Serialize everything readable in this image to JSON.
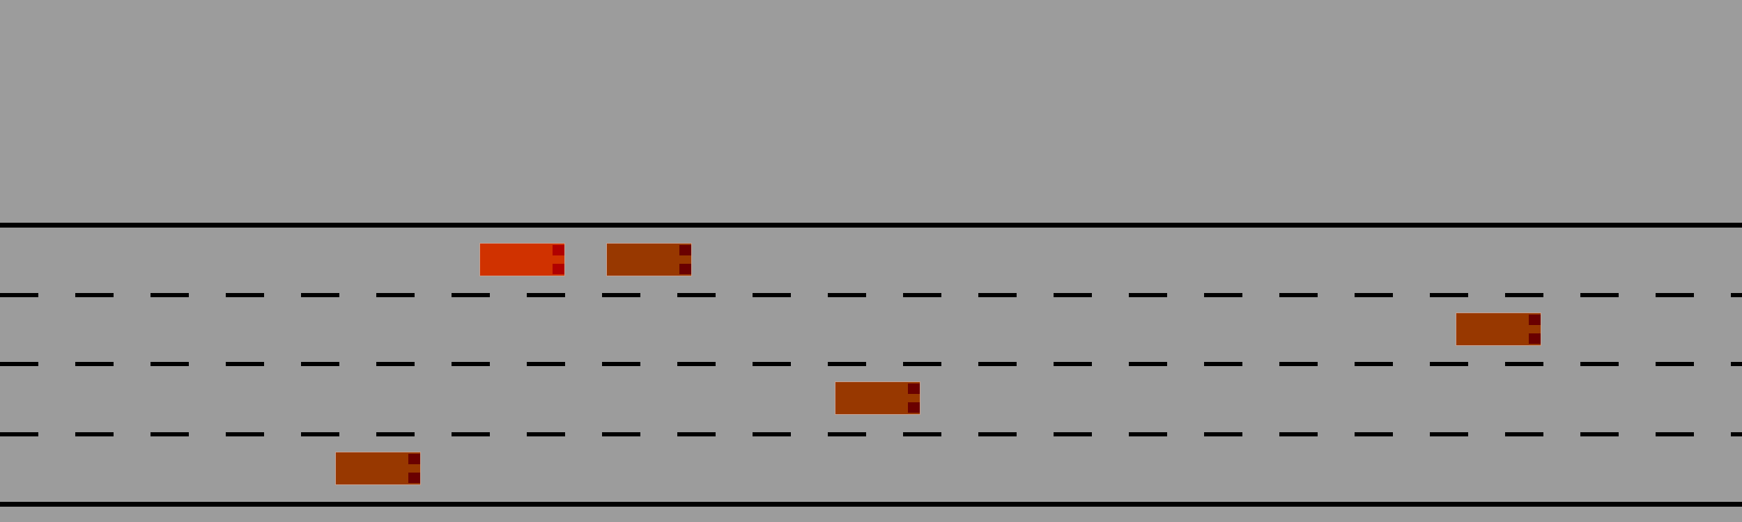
{
  "scene": {
    "background_color": "#9c9c9c",
    "road_line_color": "#000000",
    "lane_count": 4
  },
  "vehicles": [
    {
      "id": "ego",
      "role": "ego-vehicle",
      "lane": 1,
      "body_color": "#d03200",
      "light_color": "#b00000"
    },
    {
      "id": "npc-1",
      "role": "other-vehicle",
      "lane": 1,
      "body_color": "#983800",
      "light_color": "#6a0000"
    },
    {
      "id": "npc-2",
      "role": "other-vehicle",
      "lane": 2,
      "body_color": "#983800",
      "light_color": "#6a0000"
    },
    {
      "id": "npc-3",
      "role": "other-vehicle",
      "lane": 3,
      "body_color": "#983800",
      "light_color": "#6a0000"
    },
    {
      "id": "npc-4",
      "role": "other-vehicle",
      "lane": 4,
      "body_color": "#983800",
      "light_color": "#6a0000"
    }
  ]
}
